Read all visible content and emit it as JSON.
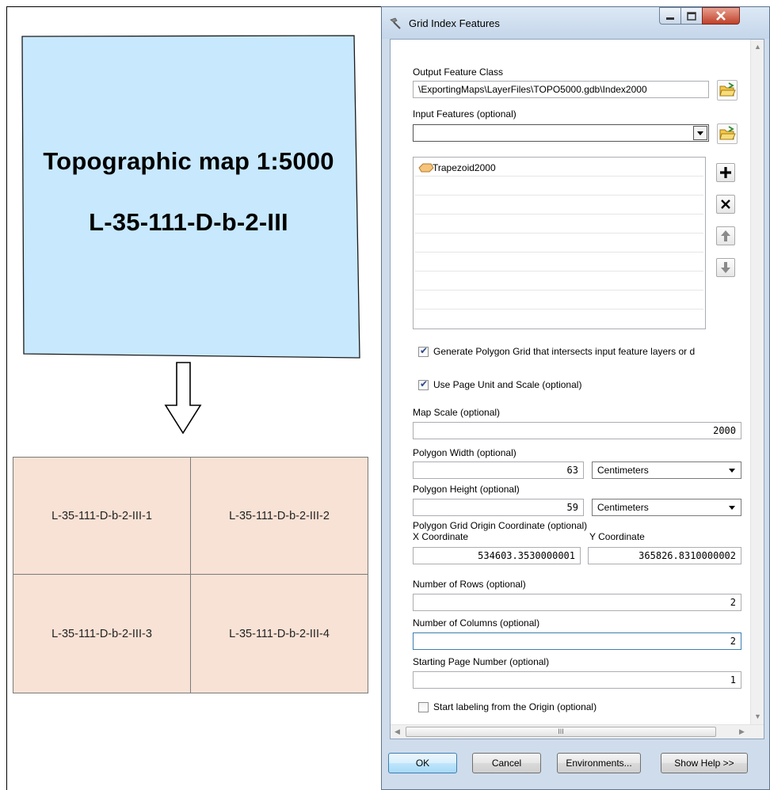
{
  "illustration": {
    "map_title": "Topographic map 1:5000",
    "map_code": "L-35-111-D-b-2-III",
    "tiles": [
      "L-35-111-D-b-2-III-1",
      "L-35-111-D-b-2-III-2",
      "L-35-111-D-b-2-III-3",
      "L-35-111-D-b-2-III-4"
    ],
    "colors": {
      "map_fill": "#c7e8fd",
      "tile_fill": "#f8e2d5"
    }
  },
  "dialog": {
    "title": "Grid Index Features",
    "output_feature_class": {
      "label": "Output Feature Class",
      "value": "\\ExportingMaps\\LayerFiles\\TOPO5000.gdb\\Index2000"
    },
    "input_features": {
      "label": "Input Features (optional)",
      "value": "",
      "items": [
        "Trapezoid2000"
      ]
    },
    "generate_polygon_grid": {
      "checked": true,
      "label": "Generate Polygon Grid that intersects input feature layers or d"
    },
    "use_page_unit": {
      "checked": true,
      "label": "Use Page Unit and Scale (optional)"
    },
    "map_scale": {
      "label": "Map Scale (optional)",
      "value": "2000"
    },
    "polygon_width": {
      "label": "Polygon Width (optional)",
      "value": "63",
      "unit": "Centimeters"
    },
    "polygon_height": {
      "label": "Polygon Height (optional)",
      "value": "59",
      "unit": "Centimeters"
    },
    "origin": {
      "label": "Polygon Grid Origin Coordinate (optional)",
      "x_label": "X Coordinate",
      "x_value": "534603.3530000001",
      "y_label": "Y Coordinate",
      "y_value": "365826.8310000002"
    },
    "rows": {
      "label": "Number of Rows (optional)",
      "value": "2"
    },
    "columns": {
      "label": "Number of Columns (optional)",
      "value": "2"
    },
    "start_page": {
      "label": "Starting Page Number (optional)",
      "value": "1"
    },
    "start_labeling_origin": {
      "checked": false,
      "label": "Start labeling from the Origin (optional)"
    },
    "scroll_thumb": "III",
    "buttons": {
      "ok": "OK",
      "cancel": "Cancel",
      "environments": "Environments...",
      "show_help": "Show Help >>"
    }
  }
}
